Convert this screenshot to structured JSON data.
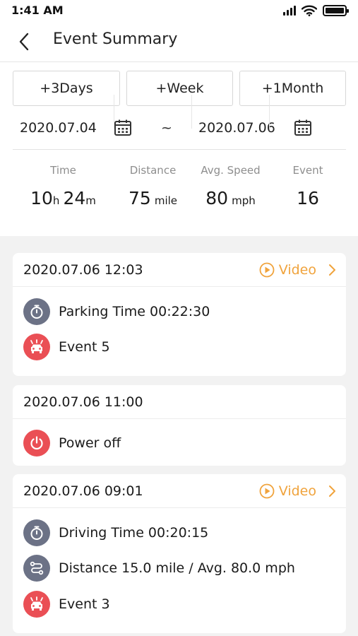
{
  "status_bar": {
    "time": "1:41 AM"
  },
  "header": {
    "title": "Event Summary",
    "back_icon": "chevron-left-icon"
  },
  "filters": {
    "buttons": [
      "+3Days",
      "+Week",
      "+1Month"
    ],
    "start_date": "2020.07.04",
    "end_date": "2020.07.06",
    "separator": "~"
  },
  "summary": {
    "time": {
      "label": "Time",
      "hours": "10",
      "hours_unit": "h",
      "minutes": "24",
      "minutes_unit": "m"
    },
    "distance": {
      "label": "Distance",
      "value": "75",
      "unit": "mile"
    },
    "avg_speed": {
      "label": "Avg. Speed",
      "value": "80",
      "unit": "mph"
    },
    "event": {
      "label": "Event",
      "value": "16"
    }
  },
  "cards": [
    {
      "datetime": "2020.07.06 12:03",
      "video_label": "Video",
      "rows": [
        {
          "icon": "stopwatch-icon",
          "text": "Parking Time  00:22:30"
        },
        {
          "icon": "car-crash-icon",
          "text": "Event  5"
        }
      ]
    },
    {
      "datetime": "2020.07.06 11:00",
      "rows": [
        {
          "icon": "power-icon",
          "text": "Power off"
        }
      ]
    },
    {
      "datetime": "2020.07.06 09:01",
      "video_label": "Video",
      "rows": [
        {
          "icon": "stopwatch-icon",
          "text": "Driving Time  00:20:15"
        },
        {
          "icon": "route-icon",
          "text": "Distance 15.0 mile / Avg. 80.0 mph"
        },
        {
          "icon": "car-crash-icon",
          "text": "Event  3"
        }
      ]
    }
  ],
  "colors": {
    "accent": "#f0a33c",
    "icon_gray": "#6c7286",
    "icon_red": "#ea4f55",
    "background": "#f2f2f2"
  }
}
